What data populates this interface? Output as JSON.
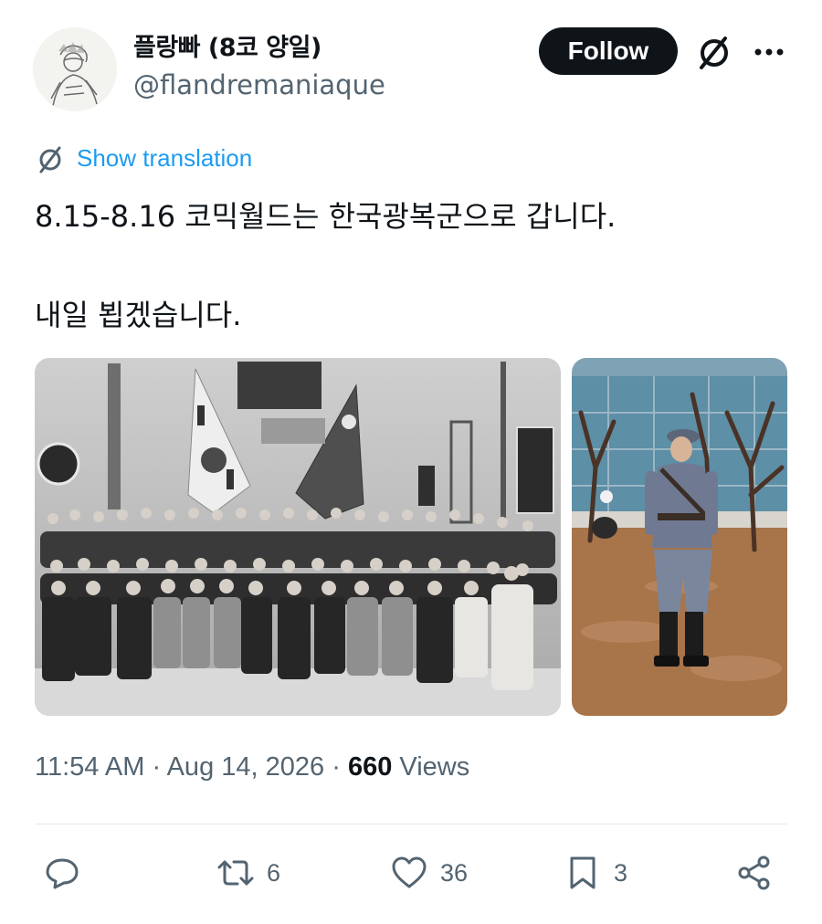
{
  "author": {
    "display_name": "플랑빠 (8코 양일)",
    "handle": "@flandremaniaque",
    "follow_label": "Follow",
    "avatar": "sketch-portrait-avatar"
  },
  "header_icons": [
    "grok-icon",
    "more-icon"
  ],
  "translation": {
    "label": "Show translation",
    "icon": "translate-icon"
  },
  "tweet": {
    "line1": "8.15-8.16 코믹월드는 한국광복군으로 갑니다.",
    "line2": "내일 뵙겠습니다."
  },
  "media": [
    {
      "name": "group-photo",
      "description_hidden": true
    },
    {
      "name": "soldier-cosplay-photo"
    }
  ],
  "meta": {
    "time": "11:54 AM",
    "separator": "·",
    "date": "Aug 14, 2026",
    "views_count": "660",
    "views_label": "Views"
  },
  "actions": {
    "reply_count": "",
    "repost_count": "6",
    "like_count": "36",
    "bookmark_count": "3"
  },
  "colors": {
    "accent": "#1d9bf0",
    "text": "#0f1419",
    "secondary": "#536471",
    "follow_bg": "#0f1419"
  }
}
